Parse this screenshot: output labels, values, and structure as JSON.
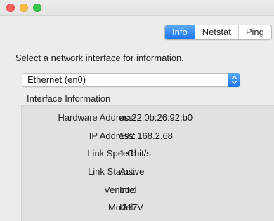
{
  "tabs": [
    {
      "label": "Info",
      "active": true
    },
    {
      "label": "Netstat",
      "active": false
    },
    {
      "label": "Ping",
      "active": false
    }
  ],
  "instruction": "Select a network interface for information.",
  "interface_select": {
    "selected": "Ethernet (en0)"
  },
  "group": {
    "title": "Interface Information",
    "rows": [
      {
        "label": "Hardware Address:",
        "value": "ac:22:0b:26:92:b0"
      },
      {
        "label": "IP Address:",
        "value": "192.168.2.68"
      },
      {
        "label": "Link Speed:",
        "value": "1 Gbit/s"
      },
      {
        "label": "Link Status:",
        "value": "Active"
      },
      {
        "label": "Vendor:",
        "value": "Intel"
      },
      {
        "label": "Model:",
        "value": "I217V"
      }
    ]
  },
  "colors": {
    "accent": "#1a75f2",
    "close": "#fc605c",
    "minimize": "#fdbc40",
    "zoom": "#34c84a"
  }
}
